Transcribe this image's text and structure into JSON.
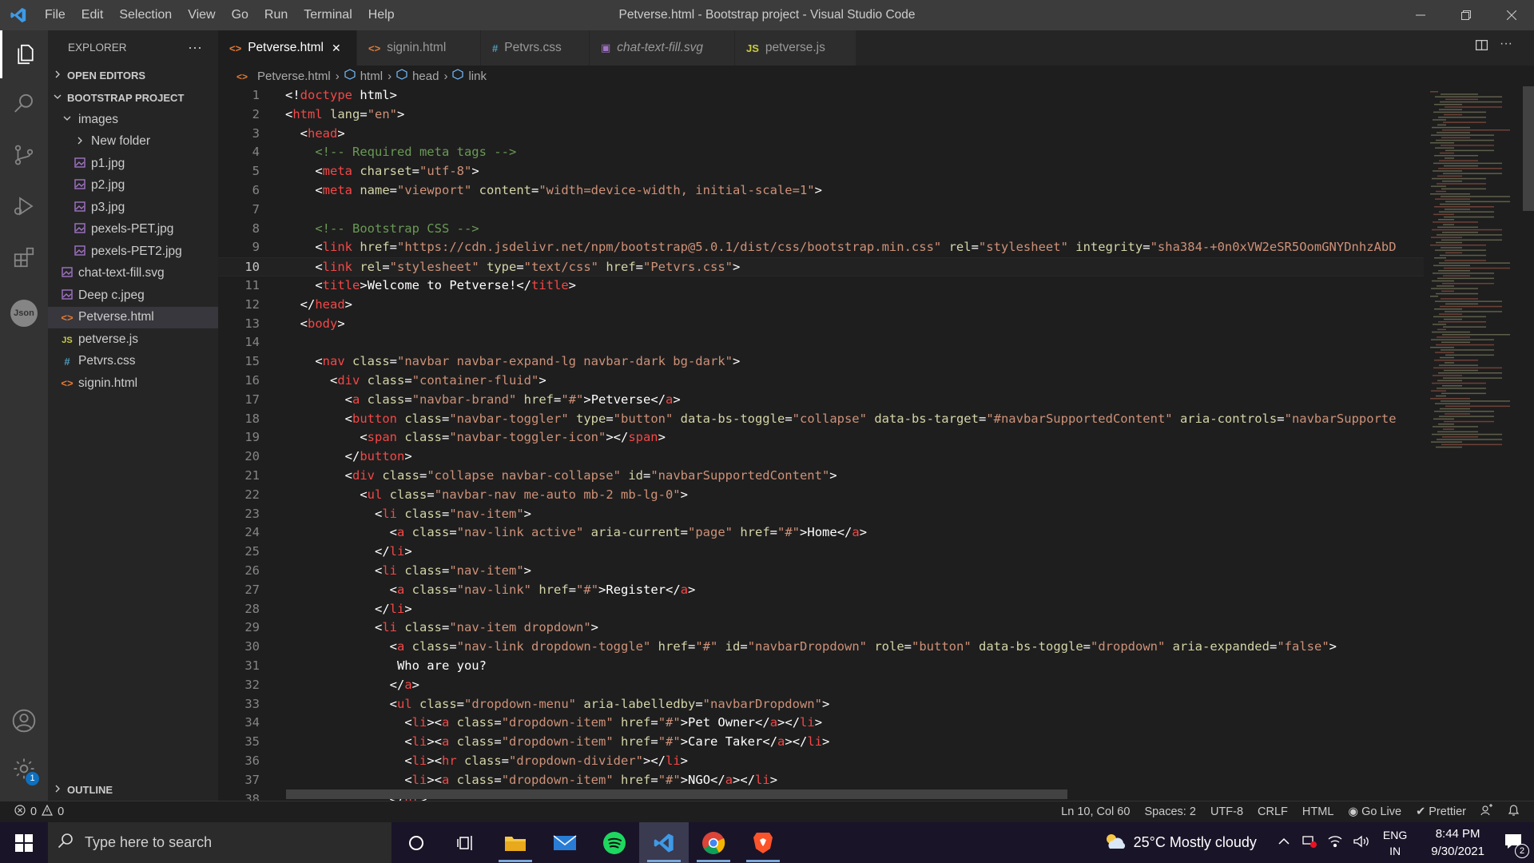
{
  "window": {
    "title": "Petverse.html - Bootstrap project - Visual Studio Code"
  },
  "menu": [
    "File",
    "Edit",
    "Selection",
    "View",
    "Go",
    "Run",
    "Terminal",
    "Help"
  ],
  "activity_icons": [
    "files-icon",
    "search-icon",
    "source-control-icon",
    "run-debug-icon",
    "extensions-icon",
    "json-icon",
    "account-icon",
    "settings-gear-icon"
  ],
  "settings_badge": "1",
  "json_label": "Json",
  "sidebar": {
    "title": "EXPLORER",
    "more": "···",
    "open_editors": "OPEN EDITORS",
    "project": "BOOTSTRAP PROJECT",
    "outline": "OUTLINE",
    "tree": [
      {
        "label": "images",
        "indent": 1,
        "type": "folder-open"
      },
      {
        "label": "New folder",
        "indent": 2,
        "type": "folder"
      },
      {
        "label": "p1.jpg",
        "indent": 2,
        "type": "image"
      },
      {
        "label": "p2.jpg",
        "indent": 2,
        "type": "image"
      },
      {
        "label": "p3.jpg",
        "indent": 2,
        "type": "image"
      },
      {
        "label": "pexels-PET.jpg",
        "indent": 2,
        "type": "image"
      },
      {
        "label": "pexels-PET2.jpg",
        "indent": 2,
        "type": "image"
      },
      {
        "label": "chat-text-fill.svg",
        "indent": 1,
        "type": "image"
      },
      {
        "label": "Deep c.jpeg",
        "indent": 1,
        "type": "image"
      },
      {
        "label": "Petverse.html",
        "indent": 1,
        "type": "html",
        "selected": true
      },
      {
        "label": "petverse.js",
        "indent": 1,
        "type": "js"
      },
      {
        "label": "Petvrs.css",
        "indent": 1,
        "type": "css"
      },
      {
        "label": "signin.html",
        "indent": 1,
        "type": "html"
      }
    ]
  },
  "tabs": [
    {
      "label": "Petverse.html",
      "icon": "<>",
      "color": "#e37933",
      "active": true
    },
    {
      "label": "signin.html",
      "icon": "<>",
      "color": "#e37933"
    },
    {
      "label": "Petvrs.css",
      "icon": "#",
      "color": "#519aba"
    },
    {
      "label": "chat-text-fill.svg",
      "icon": "▣",
      "color": "#a074c4"
    },
    {
      "label": "petverse.js",
      "icon": "JS",
      "color": "#cbcb41"
    }
  ],
  "tab_close": "✕",
  "breadcrumb": [
    "Petverse.html",
    "html",
    "head",
    "link"
  ],
  "code": [
    [
      [
        "p",
        "<!"
      ],
      [
        "t",
        "doctype"
      ],
      [
        "x",
        " html"
      ],
      [
        "p",
        ">"
      ]
    ],
    [
      [
        "p",
        "<"
      ],
      [
        "t",
        "html"
      ],
      [
        "a",
        " lang"
      ],
      [
        "p",
        "="
      ],
      [
        "s",
        "\"en\""
      ],
      [
        "p",
        ">"
      ]
    ],
    [
      [
        "x",
        "  "
      ],
      [
        "p",
        "<"
      ],
      [
        "t",
        "head"
      ],
      [
        "p",
        ">"
      ]
    ],
    [
      [
        "x",
        "    "
      ],
      [
        "c",
        "<!-- Required meta tags -->"
      ]
    ],
    [
      [
        "x",
        "    "
      ],
      [
        "p",
        "<"
      ],
      [
        "t",
        "meta"
      ],
      [
        "a",
        " charset"
      ],
      [
        "p",
        "="
      ],
      [
        "s",
        "\"utf-8\""
      ],
      [
        "p",
        ">"
      ]
    ],
    [
      [
        "x",
        "    "
      ],
      [
        "p",
        "<"
      ],
      [
        "t",
        "meta"
      ],
      [
        "a",
        " name"
      ],
      [
        "p",
        "="
      ],
      [
        "s",
        "\"viewport\""
      ],
      [
        "a",
        " content"
      ],
      [
        "p",
        "="
      ],
      [
        "s",
        "\"width=device-width, initial-scale=1\""
      ],
      [
        "p",
        ">"
      ]
    ],
    [],
    [
      [
        "x",
        "    "
      ],
      [
        "c",
        "<!-- Bootstrap CSS -->"
      ]
    ],
    [
      [
        "x",
        "    "
      ],
      [
        "p",
        "<"
      ],
      [
        "t",
        "link"
      ],
      [
        "a",
        " href"
      ],
      [
        "p",
        "="
      ],
      [
        "s",
        "\"https://cdn.jsdelivr.net/npm/bootstrap@5.0.1/dist/css/bootstrap.min.css\""
      ],
      [
        "a",
        " rel"
      ],
      [
        "p",
        "="
      ],
      [
        "s",
        "\"stylesheet\""
      ],
      [
        "a",
        " integrity"
      ],
      [
        "p",
        "="
      ],
      [
        "s",
        "\"sha384-+0n0xVW2eSR5OomGNYDnhzAbD"
      ]
    ],
    [
      [
        "x",
        "    "
      ],
      [
        "p",
        "<"
      ],
      [
        "t",
        "link"
      ],
      [
        "a",
        " rel"
      ],
      [
        "p",
        "="
      ],
      [
        "s",
        "\"stylesheet\""
      ],
      [
        "a",
        " type"
      ],
      [
        "p",
        "="
      ],
      [
        "s",
        "\"text/css\""
      ],
      [
        "a",
        " href"
      ],
      [
        "p",
        "="
      ],
      [
        "s",
        "\"Petvrs.css\""
      ],
      [
        "p",
        ">"
      ]
    ],
    [
      [
        "x",
        "    "
      ],
      [
        "p",
        "<"
      ],
      [
        "t",
        "title"
      ],
      [
        "p",
        ">"
      ],
      [
        "x",
        "Welcome to Petverse!"
      ],
      [
        "p",
        "</"
      ],
      [
        "t",
        "title"
      ],
      [
        "p",
        ">"
      ]
    ],
    [
      [
        "x",
        "  "
      ],
      [
        "p",
        "</"
      ],
      [
        "t",
        "head"
      ],
      [
        "p",
        ">"
      ]
    ],
    [
      [
        "x",
        "  "
      ],
      [
        "p",
        "<"
      ],
      [
        "t",
        "body"
      ],
      [
        "p",
        ">"
      ]
    ],
    [],
    [
      [
        "x",
        "    "
      ],
      [
        "p",
        "<"
      ],
      [
        "t",
        "nav"
      ],
      [
        "a",
        " class"
      ],
      [
        "p",
        "="
      ],
      [
        "s",
        "\"navbar navbar-expand-lg navbar-dark bg-dark\""
      ],
      [
        "p",
        ">"
      ]
    ],
    [
      [
        "x",
        "      "
      ],
      [
        "p",
        "<"
      ],
      [
        "t",
        "div"
      ],
      [
        "a",
        " class"
      ],
      [
        "p",
        "="
      ],
      [
        "s",
        "\"container-fluid\""
      ],
      [
        "p",
        ">"
      ]
    ],
    [
      [
        "x",
        "        "
      ],
      [
        "p",
        "<"
      ],
      [
        "t",
        "a"
      ],
      [
        "a",
        " class"
      ],
      [
        "p",
        "="
      ],
      [
        "s",
        "\"navbar-brand\""
      ],
      [
        "a",
        " href"
      ],
      [
        "p",
        "="
      ],
      [
        "s",
        "\"#\""
      ],
      [
        "p",
        ">"
      ],
      [
        "x",
        "Petverse"
      ],
      [
        "p",
        "</"
      ],
      [
        "t",
        "a"
      ],
      [
        "p",
        ">"
      ]
    ],
    [
      [
        "x",
        "        "
      ],
      [
        "p",
        "<"
      ],
      [
        "t",
        "button"
      ],
      [
        "a",
        " class"
      ],
      [
        "p",
        "="
      ],
      [
        "s",
        "\"navbar-toggler\""
      ],
      [
        "a",
        " type"
      ],
      [
        "p",
        "="
      ],
      [
        "s",
        "\"button\""
      ],
      [
        "a",
        " data-bs-toggle"
      ],
      [
        "p",
        "="
      ],
      [
        "s",
        "\"collapse\""
      ],
      [
        "a",
        " data-bs-target"
      ],
      [
        "p",
        "="
      ],
      [
        "s",
        "\"#navbarSupportedContent\""
      ],
      [
        "a",
        " aria-controls"
      ],
      [
        "p",
        "="
      ],
      [
        "s",
        "\"navbarSupporte"
      ]
    ],
    [
      [
        "x",
        "          "
      ],
      [
        "p",
        "<"
      ],
      [
        "t",
        "span"
      ],
      [
        "a",
        " class"
      ],
      [
        "p",
        "="
      ],
      [
        "s",
        "\"navbar-toggler-icon\""
      ],
      [
        "p",
        "></"
      ],
      [
        "t",
        "span"
      ],
      [
        "p",
        ">"
      ]
    ],
    [
      [
        "x",
        "        "
      ],
      [
        "p",
        "</"
      ],
      [
        "t",
        "button"
      ],
      [
        "p",
        ">"
      ]
    ],
    [
      [
        "x",
        "        "
      ],
      [
        "p",
        "<"
      ],
      [
        "t",
        "div"
      ],
      [
        "a",
        " class"
      ],
      [
        "p",
        "="
      ],
      [
        "s",
        "\"collapse navbar-collapse\""
      ],
      [
        "a",
        " id"
      ],
      [
        "p",
        "="
      ],
      [
        "s",
        "\"navbarSupportedContent\""
      ],
      [
        "p",
        ">"
      ]
    ],
    [
      [
        "x",
        "          "
      ],
      [
        "p",
        "<"
      ],
      [
        "t",
        "ul"
      ],
      [
        "a",
        " class"
      ],
      [
        "p",
        "="
      ],
      [
        "s",
        "\"navbar-nav me-auto mb-2 mb-lg-0\""
      ],
      [
        "p",
        ">"
      ]
    ],
    [
      [
        "x",
        "            "
      ],
      [
        "p",
        "<"
      ],
      [
        "t",
        "li"
      ],
      [
        "a",
        " class"
      ],
      [
        "p",
        "="
      ],
      [
        "s",
        "\"nav-item\""
      ],
      [
        "p",
        ">"
      ]
    ],
    [
      [
        "x",
        "              "
      ],
      [
        "p",
        "<"
      ],
      [
        "t",
        "a"
      ],
      [
        "a",
        " class"
      ],
      [
        "p",
        "="
      ],
      [
        "s",
        "\"nav-link active\""
      ],
      [
        "a",
        " aria-current"
      ],
      [
        "p",
        "="
      ],
      [
        "s",
        "\"page\""
      ],
      [
        "a",
        " href"
      ],
      [
        "p",
        "="
      ],
      [
        "s",
        "\"#\""
      ],
      [
        "p",
        ">"
      ],
      [
        "x",
        "Home"
      ],
      [
        "p",
        "</"
      ],
      [
        "t",
        "a"
      ],
      [
        "p",
        ">"
      ]
    ],
    [
      [
        "x",
        "            "
      ],
      [
        "p",
        "</"
      ],
      [
        "t",
        "li"
      ],
      [
        "p",
        ">"
      ]
    ],
    [
      [
        "x",
        "            "
      ],
      [
        "p",
        "<"
      ],
      [
        "t",
        "li"
      ],
      [
        "a",
        " class"
      ],
      [
        "p",
        "="
      ],
      [
        "s",
        "\"nav-item\""
      ],
      [
        "p",
        ">"
      ]
    ],
    [
      [
        "x",
        "              "
      ],
      [
        "p",
        "<"
      ],
      [
        "t",
        "a"
      ],
      [
        "a",
        " class"
      ],
      [
        "p",
        "="
      ],
      [
        "s",
        "\"nav-link\""
      ],
      [
        "a",
        " href"
      ],
      [
        "p",
        "="
      ],
      [
        "s",
        "\"#\""
      ],
      [
        "p",
        ">"
      ],
      [
        "x",
        "Register"
      ],
      [
        "p",
        "</"
      ],
      [
        "t",
        "a"
      ],
      [
        "p",
        ">"
      ]
    ],
    [
      [
        "x",
        "            "
      ],
      [
        "p",
        "</"
      ],
      [
        "t",
        "li"
      ],
      [
        "p",
        ">"
      ]
    ],
    [
      [
        "x",
        "            "
      ],
      [
        "p",
        "<"
      ],
      [
        "t",
        "li"
      ],
      [
        "a",
        " class"
      ],
      [
        "p",
        "="
      ],
      [
        "s",
        "\"nav-item dropdown\""
      ],
      [
        "p",
        ">"
      ]
    ],
    [
      [
        "x",
        "              "
      ],
      [
        "p",
        "<"
      ],
      [
        "t",
        "a"
      ],
      [
        "a",
        " class"
      ],
      [
        "p",
        "="
      ],
      [
        "s",
        "\"nav-link dropdown-toggle\""
      ],
      [
        "a",
        " href"
      ],
      [
        "p",
        "="
      ],
      [
        "s",
        "\"#\""
      ],
      [
        "a",
        " id"
      ],
      [
        "p",
        "="
      ],
      [
        "s",
        "\"navbarDropdown\""
      ],
      [
        "a",
        " role"
      ],
      [
        "p",
        "="
      ],
      [
        "s",
        "\"button\""
      ],
      [
        "a",
        " data-bs-toggle"
      ],
      [
        "p",
        "="
      ],
      [
        "s",
        "\"dropdown\""
      ],
      [
        "a",
        " aria-expanded"
      ],
      [
        "p",
        "="
      ],
      [
        "s",
        "\"false\""
      ],
      [
        "p",
        ">"
      ]
    ],
    [
      [
        "x",
        "               Who are you?"
      ]
    ],
    [
      [
        "x",
        "              "
      ],
      [
        "p",
        "</"
      ],
      [
        "t",
        "a"
      ],
      [
        "p",
        ">"
      ]
    ],
    [
      [
        "x",
        "              "
      ],
      [
        "p",
        "<"
      ],
      [
        "t",
        "ul"
      ],
      [
        "a",
        " class"
      ],
      [
        "p",
        "="
      ],
      [
        "s",
        "\"dropdown-menu\""
      ],
      [
        "a",
        " aria-labelledby"
      ],
      [
        "p",
        "="
      ],
      [
        "s",
        "\"navbarDropdown\""
      ],
      [
        "p",
        ">"
      ]
    ],
    [
      [
        "x",
        "                "
      ],
      [
        "p",
        "<"
      ],
      [
        "t",
        "li"
      ],
      [
        "p",
        "><"
      ],
      [
        "t",
        "a"
      ],
      [
        "a",
        " class"
      ],
      [
        "p",
        "="
      ],
      [
        "s",
        "\"dropdown-item\""
      ],
      [
        "a",
        " href"
      ],
      [
        "p",
        "="
      ],
      [
        "s",
        "\"#\""
      ],
      [
        "p",
        ">"
      ],
      [
        "x",
        "Pet Owner"
      ],
      [
        "p",
        "</"
      ],
      [
        "t",
        "a"
      ],
      [
        "p",
        "></"
      ],
      [
        "t",
        "li"
      ],
      [
        "p",
        ">"
      ]
    ],
    [
      [
        "x",
        "                "
      ],
      [
        "p",
        "<"
      ],
      [
        "t",
        "li"
      ],
      [
        "p",
        "><"
      ],
      [
        "t",
        "a"
      ],
      [
        "a",
        " class"
      ],
      [
        "p",
        "="
      ],
      [
        "s",
        "\"dropdown-item\""
      ],
      [
        "a",
        " href"
      ],
      [
        "p",
        "="
      ],
      [
        "s",
        "\"#\""
      ],
      [
        "p",
        ">"
      ],
      [
        "x",
        "Care Taker"
      ],
      [
        "p",
        "</"
      ],
      [
        "t",
        "a"
      ],
      [
        "p",
        "></"
      ],
      [
        "t",
        "li"
      ],
      [
        "p",
        ">"
      ]
    ],
    [
      [
        "x",
        "                "
      ],
      [
        "p",
        "<"
      ],
      [
        "t",
        "li"
      ],
      [
        "p",
        "><"
      ],
      [
        "t",
        "hr"
      ],
      [
        "a",
        " class"
      ],
      [
        "p",
        "="
      ],
      [
        "s",
        "\"dropdown-divider\""
      ],
      [
        "p",
        "></"
      ],
      [
        "t",
        "li"
      ],
      [
        "p",
        ">"
      ]
    ],
    [
      [
        "x",
        "                "
      ],
      [
        "p",
        "<"
      ],
      [
        "t",
        "li"
      ],
      [
        "p",
        "><"
      ],
      [
        "t",
        "a"
      ],
      [
        "a",
        " class"
      ],
      [
        "p",
        "="
      ],
      [
        "s",
        "\"dropdown-item\""
      ],
      [
        "a",
        " href"
      ],
      [
        "p",
        "="
      ],
      [
        "s",
        "\"#\""
      ],
      [
        "p",
        ">"
      ],
      [
        "x",
        "NGO"
      ],
      [
        "p",
        "</"
      ],
      [
        "t",
        "a"
      ],
      [
        "p",
        "></"
      ],
      [
        "t",
        "li"
      ],
      [
        "p",
        ">"
      ]
    ],
    [
      [
        "x",
        "              "
      ],
      [
        "p",
        "</"
      ],
      [
        "t",
        "ul"
      ],
      [
        "p",
        ">"
      ]
    ]
  ],
  "current_line": 10,
  "status": {
    "errors": "0",
    "warnings": "0",
    "position": "Ln 10, Col 60",
    "spaces": "Spaces: 2",
    "encoding": "UTF-8",
    "eol": "CRLF",
    "language": "HTML",
    "golive": "Go Live",
    "prettier": "Prettier"
  },
  "taskbar": {
    "search_placeholder": "Type here to search",
    "weather": "25°C  Mostly cloudy",
    "lang": "ENG",
    "region": "IN",
    "time": "8:44 PM",
    "date": "9/30/2021",
    "notif_count": "2"
  }
}
